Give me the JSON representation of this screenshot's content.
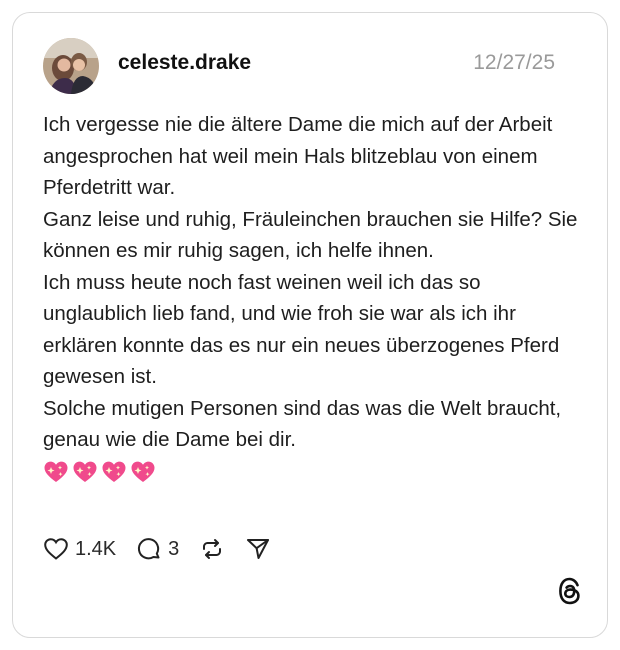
{
  "post": {
    "username": "celeste.drake",
    "date": "12/27/25",
    "avatar": "profile-photo",
    "paragraphs": [
      "Ich vergesse nie die ältere Dame die mich auf der Arbeit angesprochen hat weil mein Hals blitzeblau von einem Pferdetritt war.",
      "Ganz leise und ruhig, Fräuleinchen brauchen sie Hilfe? Sie können es mir ruhig sagen, ich helfe ihnen.",
      "Ich muss heute noch fast weinen weil ich das so unglaublich lieb fand, und wie froh sie war als ich ihr erklären konnte das es nur ein neues überzogenes Pferd gewesen ist.",
      "Solche mutigen Personen sind das was die Welt braucht, genau wie die Dame bei dir."
    ],
    "emoji_count": 4,
    "emoji": "sparkling-heart"
  },
  "actions": {
    "like_count": "1.4K",
    "reply_count": "3",
    "like_icon": "heart-icon",
    "reply_icon": "comment-icon",
    "repost_icon": "repost-icon",
    "share_icon": "send-icon"
  },
  "brand": {
    "logo": "threads-logo",
    "heart_color": "#f04a8c"
  }
}
